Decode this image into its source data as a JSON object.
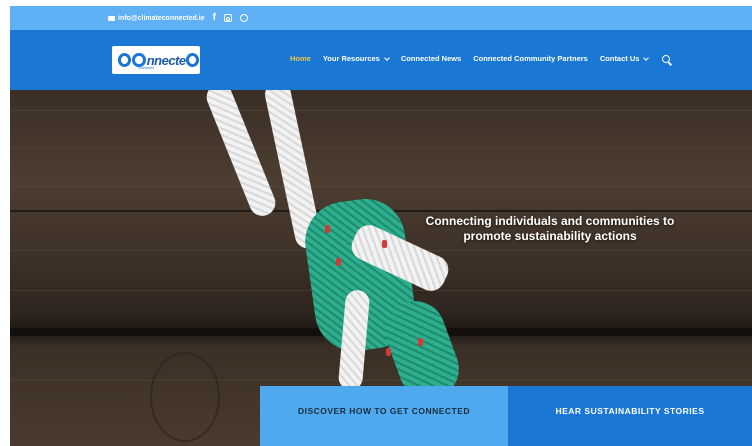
{
  "topbar": {
    "email": "info@climateconnected.ie",
    "icons": [
      "mail-icon",
      "facebook-icon",
      "instagram-icon",
      "whatsapp-icon"
    ],
    "facebook_glyph": "f"
  },
  "header": {
    "logo_text": "nnecte",
    "logo_tagline": "connected",
    "nav": [
      {
        "label": "Home",
        "active": true,
        "dropdown": false
      },
      {
        "label": "Your Resources",
        "active": false,
        "dropdown": true
      },
      {
        "label": "Connected News",
        "active": false,
        "dropdown": false
      },
      {
        "label": "Connected Community Partners",
        "active": false,
        "dropdown": false
      },
      {
        "label": "Contact Us",
        "active": false,
        "dropdown": true
      }
    ]
  },
  "hero": {
    "headline": "Connecting individuals and communities to promote sustainability actions"
  },
  "cta": {
    "left": "DISCOVER HOW TO GET CONNECTED",
    "right": "HEAR SUSTAINABILITY STORIES"
  },
  "colors": {
    "topbar": "#5fb0f4",
    "header": "#1a78d4",
    "active_nav": "#f4c542",
    "cta_left": "#4ea9ef",
    "cta_right": "#1a78d4"
  }
}
